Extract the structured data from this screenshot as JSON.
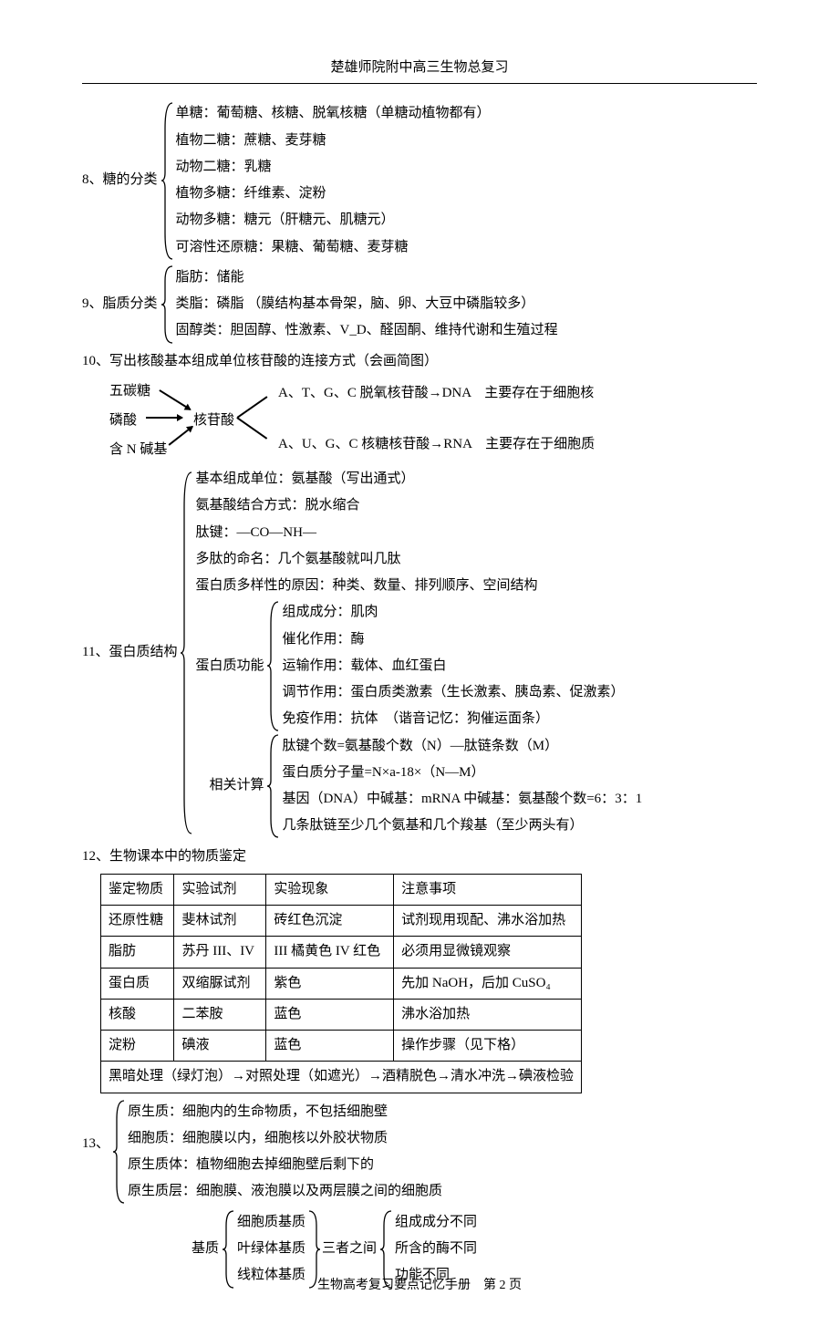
{
  "header": "楚雄师院附中高三生物总复习",
  "footer": "生物高考复习要点记忆手册　第 2 页",
  "s8": {
    "label": "8、糖的分类",
    "lines": [
      "单糖：葡萄糖、核糖、脱氧核糖（单糖动植物都有）",
      "植物二糖：蔗糖、麦芽糖",
      "动物二糖：乳糖",
      "植物多糖：纤维素、淀粉",
      "动物多糖：糖元（肝糖元、肌糖元）",
      "可溶性还原糖：果糖、葡萄糖、麦芽糖"
    ]
  },
  "s9": {
    "label": "9、脂质分类",
    "lines": [
      "脂肪：储能",
      "类脂：磷脂 （膜结构基本骨架，脑、卵、大豆中磷脂较多）",
      "固醇类：胆固醇、性激素、V_D、醛固酮、维持代谢和生殖过程"
    ]
  },
  "s10": {
    "title": "10、写出核酸基本组成单位核苷酸的连接方式（会画简图）",
    "left": [
      "五碳糖",
      "磷酸",
      "含 N 碱基"
    ],
    "center": "核苷酸",
    "right": [
      "A、T、G、C 脱氧核苷酸→DNA　主要存在于细胞核",
      "A、U、G、C 核糖核苷酸→RNA　主要存在于细胞质"
    ]
  },
  "s11": {
    "label": "11、蛋白质结构",
    "top": [
      "基本组成单位：氨基酸（写出通式）",
      "氨基酸结合方式：脱水缩合",
      "肽键：—CO—NH—",
      "多肽的命名：几个氨基酸就叫几肽",
      "蛋白质多样性的原因：种类、数量、排列顺序、空间结构"
    ],
    "func_label": "蛋白质功能",
    "func": [
      "组成成分：肌肉",
      "催化作用：酶",
      "运输作用：载体、血红蛋白",
      "调节作用：蛋白质类激素（生长激素、胰岛素、促激素）",
      "免疫作用：抗体　（谐音记忆：狗催运面条）"
    ],
    "calc_label": "相关计算",
    "calc": [
      "肽键个数=氨基酸个数（N）—肽链条数（M）",
      "蛋白质分子量=N×a-18×（N—M）",
      "基因（DNA）中碱基：mRNA 中碱基：氨基酸个数=6：3：1",
      "几条肽链至少几个氨基和几个羧基（至少两头有）"
    ]
  },
  "s12": {
    "title": "12、生物课本中的物质鉴定",
    "headers": [
      "鉴定物质",
      "实验试剂",
      "实验现象",
      "注意事项"
    ],
    "rows": [
      [
        "还原性糖",
        "斐林试剂",
        "砖红色沉淀",
        "试剂现用现配、沸水浴加热"
      ],
      [
        "脂肪",
        "苏丹 III、IV",
        "III 橘黄色 IV 红色",
        "必须用显微镜观察"
      ],
      [
        "蛋白质",
        "双缩脲试剂",
        "紫色",
        "先加 NaOH，后加 CuSO₄"
      ],
      [
        "核酸",
        "二苯胺",
        "蓝色",
        "沸水浴加热"
      ],
      [
        "淀粉",
        "碘液",
        "蓝色",
        "操作步骤（见下格）"
      ]
    ],
    "footrow": "黑暗处理（绿灯泡）→对照处理（如遮光）→酒精脱色→清水冲洗→碘液检验"
  },
  "s13": {
    "label": "13、",
    "lines": [
      "原生质：细胞内的生命物质，不包括细胞壁",
      "细胞质：细胞膜以内，细胞核以外胶状物质",
      "原生质体：植物细胞去掉细胞壁后剩下的",
      "原生质层：细胞膜、液泡膜以及两层膜之间的细胞质"
    ],
    "sub_label": "基质",
    "sub_left": [
      "细胞质基质",
      "叶绿体基质",
      "线粒体基质"
    ],
    "sub_mid": "三者之间",
    "sub_right": [
      "组成成分不同",
      "所含的酶不同",
      "功能不同"
    ]
  }
}
